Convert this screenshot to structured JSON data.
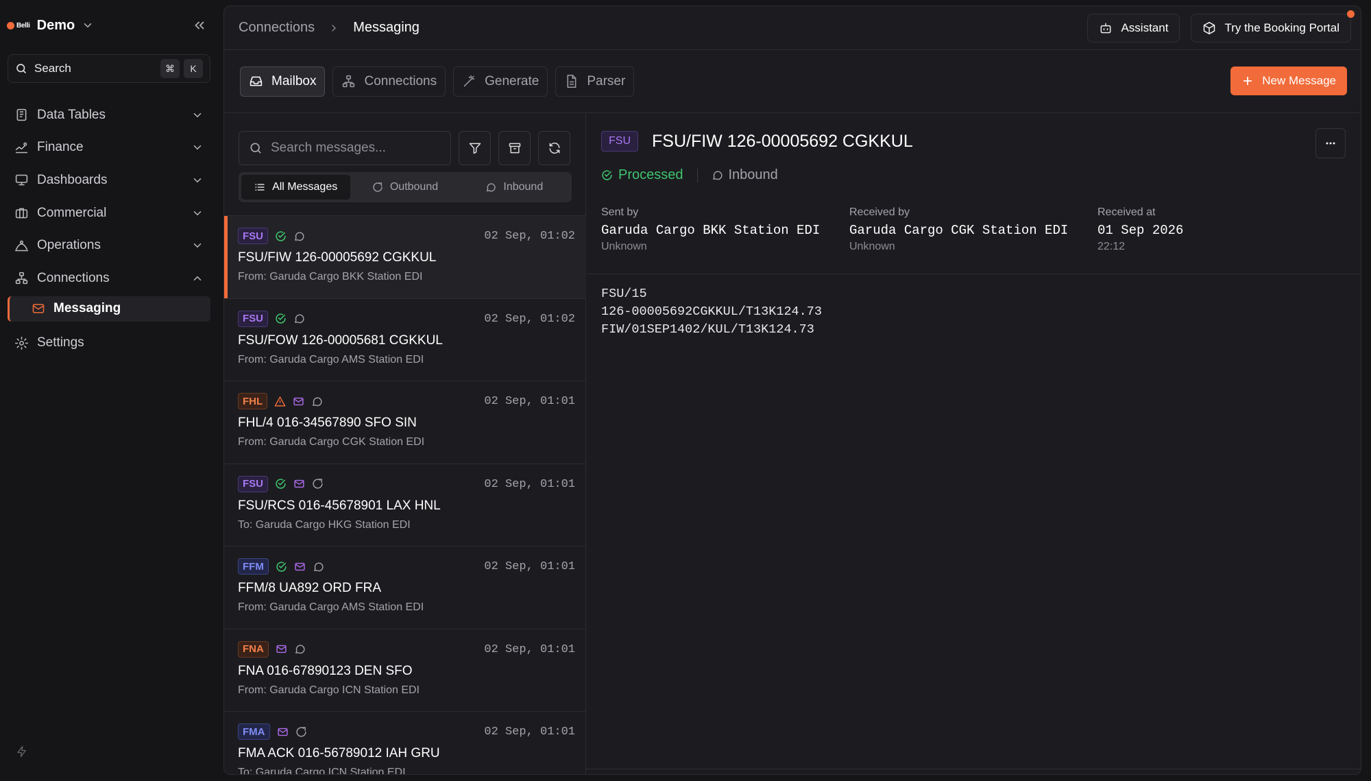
{
  "sidebar": {
    "logo_text": "Belli",
    "workspace": "Demo",
    "search_label": "Search",
    "search_kbd": [
      "⌘",
      "K"
    ],
    "nav": [
      {
        "label": "Data Tables",
        "icon": "table-icon"
      },
      {
        "label": "Finance",
        "icon": "finance-icon"
      },
      {
        "label": "Dashboards",
        "icon": "monitor-icon"
      },
      {
        "label": "Commercial",
        "icon": "briefcase-icon"
      },
      {
        "label": "Operations",
        "icon": "operations-icon"
      },
      {
        "label": "Connections",
        "icon": "network-icon",
        "expanded": true
      }
    ],
    "sub_item": "Messaging",
    "settings": "Settings"
  },
  "header": {
    "breadcrumb_parent": "Connections",
    "breadcrumb_current": "Messaging",
    "assistant_label": "Assistant",
    "portal_label": "Try the Booking Portal"
  },
  "tabs": [
    {
      "label": "Mailbox",
      "active": true
    },
    {
      "label": "Connections",
      "active": false
    },
    {
      "label": "Generate",
      "active": false
    },
    {
      "label": "Parser",
      "active": false
    }
  ],
  "new_message_label": "New Message",
  "list": {
    "search_placeholder": "Search messages...",
    "filters": [
      "All Messages",
      "Outbound",
      "Inbound"
    ],
    "messages": [
      {
        "type": "FSU",
        "status": "processed",
        "channel": null,
        "direction": "inbound",
        "time": "02 Sep, 01:02",
        "title": "FSU/FIW 126-00005692 CGKKUL",
        "from": "From: Garuda Cargo BKK Station EDI",
        "selected": true
      },
      {
        "type": "FSU",
        "status": "processed",
        "channel": null,
        "direction": "inbound",
        "time": "02 Sep, 01:02",
        "title": "FSU/FOW 126-00005681 CGKKUL",
        "from": "From: Garuda Cargo AMS Station EDI"
      },
      {
        "type": "FHL",
        "status": "warning",
        "channel": "email",
        "direction": "inbound",
        "time": "02 Sep, 01:01",
        "title": "FHL/4 016-34567890 SFO SIN",
        "from": "From: Garuda Cargo CGK Station EDI"
      },
      {
        "type": "FSU",
        "status": "processed",
        "channel": "email",
        "direction": "outbound",
        "time": "02 Sep, 01:01",
        "title": "FSU/RCS 016-45678901 LAX HNL",
        "from": "To: Garuda Cargo HKG Station EDI"
      },
      {
        "type": "FFM",
        "status": "processed",
        "channel": "email",
        "direction": "inbound",
        "time": "02 Sep, 01:01",
        "title": "FFM/8 UA892 ORD FRA",
        "from": "From: Garuda Cargo AMS Station EDI"
      },
      {
        "type": "FNA",
        "status": null,
        "channel": "email",
        "direction": "inbound",
        "time": "02 Sep, 01:01",
        "title": "FNA 016-67890123 DEN SFO",
        "from": "From: Garuda Cargo ICN Station EDI"
      },
      {
        "type": "FMA",
        "status": null,
        "channel": "email",
        "direction": "outbound",
        "time": "02 Sep, 01:01",
        "title": "FMA ACK 016-56789012 IAH GRU",
        "from": "To: Garuda Cargo ICN Station EDI"
      }
    ]
  },
  "detail": {
    "type": "FSU",
    "title": "FSU/FIW 126-00005692 CGKKUL",
    "status": "Processed",
    "direction": "Inbound",
    "meta": [
      {
        "label": "Sent by",
        "value": "Garuda Cargo BKK Station EDI",
        "sub": "Unknown"
      },
      {
        "label": "Received by",
        "value": "Garuda Cargo CGK Station EDI",
        "sub": "Unknown"
      },
      {
        "label": "Received at",
        "value": "01 Sep 2026",
        "sub": "22:12"
      }
    ],
    "body_lines": [
      "FSU/15",
      "126-00005692CGKKUL/T13K124.73",
      "FIW/01SEP1402/KUL/T13K124.73"
    ]
  },
  "colors": {
    "accent": "#f26b3a",
    "success": "#3ec46d",
    "channel": "#b16cf0"
  }
}
